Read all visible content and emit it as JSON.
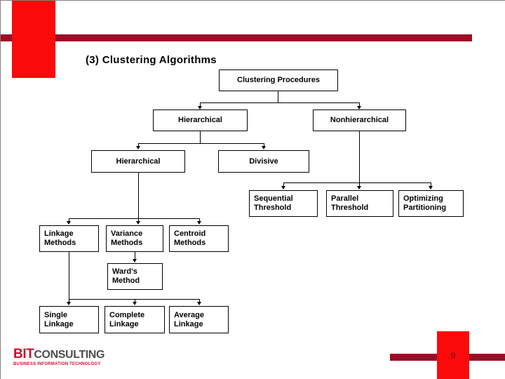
{
  "slide": {
    "title": "(3) Clustering Algorithms",
    "page_number": "9",
    "accent_red": "#fa0a0a",
    "accent_dark_red": "#9e0b28"
  },
  "logo": {
    "brand_bold": "BIT",
    "brand_rest": "CONSULTING",
    "tagline": "BUSINESS INFORMATION TECHNOLOGY"
  },
  "chart_data": {
    "type": "diagram",
    "title": "Clustering Procedures",
    "nodes": [
      {
        "id": "root",
        "label": "Clustering Procedures"
      },
      {
        "id": "hier1",
        "label": "Hierarchical"
      },
      {
        "id": "nonhier",
        "label": "Nonhierarchical"
      },
      {
        "id": "hier2",
        "label": "Hierarchical"
      },
      {
        "id": "divisive",
        "label": "Divisive"
      },
      {
        "id": "seq_thresh",
        "label": "Sequential\nThreshold"
      },
      {
        "id": "par_thresh",
        "label": "Parallel\nThreshold"
      },
      {
        "id": "opt_part",
        "label": "Optimizing\nPartitioning"
      },
      {
        "id": "linkage",
        "label": "Linkage\nMethods"
      },
      {
        "id": "variance",
        "label": "Variance\nMethods"
      },
      {
        "id": "centroid",
        "label": "Centroid\nMethods"
      },
      {
        "id": "wards",
        "label": "Ward's\nMethod"
      },
      {
        "id": "single",
        "label": "Single\nLinkage"
      },
      {
        "id": "complete",
        "label": "Complete\nLinkage"
      },
      {
        "id": "average",
        "label": "Average\nLinkage"
      }
    ],
    "edges": [
      {
        "from": "root",
        "to": "hier1"
      },
      {
        "from": "root",
        "to": "nonhier"
      },
      {
        "from": "hier1",
        "to": "hier2"
      },
      {
        "from": "hier1",
        "to": "divisive"
      },
      {
        "from": "nonhier",
        "to": "seq_thresh"
      },
      {
        "from": "nonhier",
        "to": "par_thresh"
      },
      {
        "from": "nonhier",
        "to": "opt_part"
      },
      {
        "from": "hier2",
        "to": "linkage"
      },
      {
        "from": "hier2",
        "to": "variance"
      },
      {
        "from": "hier2",
        "to": "centroid"
      },
      {
        "from": "variance",
        "to": "wards"
      },
      {
        "from": "linkage",
        "to": "single"
      },
      {
        "from": "linkage",
        "to": "complete"
      },
      {
        "from": "linkage",
        "to": "average"
      }
    ]
  },
  "nodes": {
    "root": {
      "label": "Clustering Procedures"
    },
    "hier1": {
      "label": "Hierarchical"
    },
    "nonhier": {
      "label": "Nonhierarchical"
    },
    "hier2": {
      "label": "Hierarchical"
    },
    "divisive": {
      "label": "Divisive"
    },
    "seq_thresh_l1": {
      "label": "Sequential"
    },
    "seq_thresh_l2": {
      "label": "Threshold"
    },
    "par_thresh_l1": {
      "label": "Parallel"
    },
    "par_thresh_l2": {
      "label": "Threshold"
    },
    "opt_part_l1": {
      "label": "Optimizing"
    },
    "opt_part_l2": {
      "label": "Partitioning"
    },
    "linkage_l1": {
      "label": "Linkage"
    },
    "linkage_l2": {
      "label": "Methods"
    },
    "variance_l1": {
      "label": "Variance"
    },
    "variance_l2": {
      "label": "Methods"
    },
    "centroid_l1": {
      "label": "Centroid"
    },
    "centroid_l2": {
      "label": "Methods"
    },
    "wards_l1": {
      "label": "Ward's"
    },
    "wards_l2": {
      "label": "Method"
    },
    "single_l1": {
      "label": "Single"
    },
    "single_l2": {
      "label": "Linkage"
    },
    "complete_l1": {
      "label": "Complete"
    },
    "complete_l2": {
      "label": "Linkage"
    },
    "average_l1": {
      "label": "Average"
    },
    "average_l2": {
      "label": "Linkage"
    }
  }
}
